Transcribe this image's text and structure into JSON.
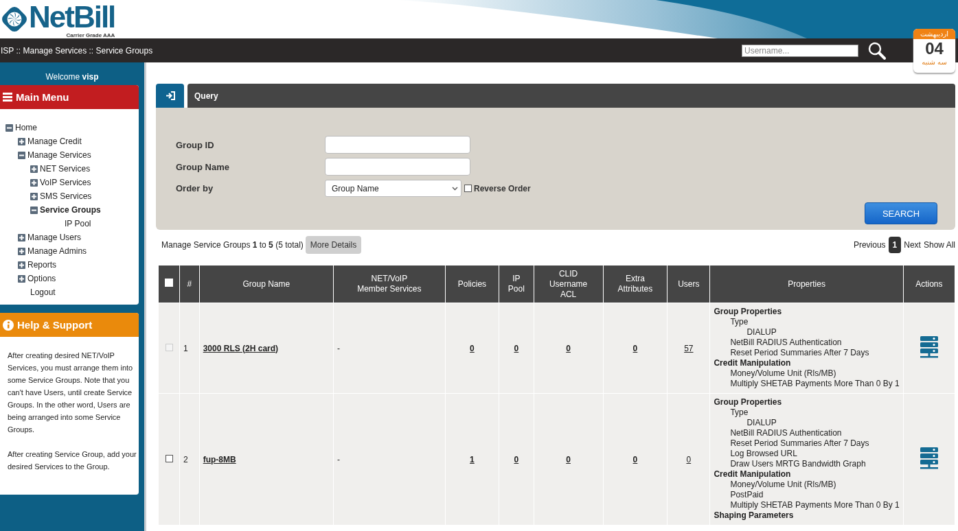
{
  "logo": {
    "name": "NetBill",
    "tagline": "Carrier Grade AAA"
  },
  "breadcrumb": "ISP :: Manage Services :: Service Groups",
  "search": {
    "placeholder": "Username..."
  },
  "calendar": {
    "month": "اردیبهشت",
    "day": "04",
    "weekday": "سه شنبه"
  },
  "sidebar": {
    "welcome": "Welcome **visp**",
    "menu_title": "Main Menu",
    "tree": [
      {
        "label": "Home",
        "kind": "expanded",
        "selected": false,
        "children": [
          {
            "label": "Manage Credit",
            "kind": "collapsed",
            "selected": false
          },
          {
            "label": "Manage Services",
            "kind": "expanded",
            "selected": false,
            "children": [
              {
                "label": "NET Services",
                "kind": "collapsed",
                "selected": false
              },
              {
                "label": "VoIP Services",
                "kind": "collapsed",
                "selected": false
              },
              {
                "label": "SMS Services",
                "kind": "collapsed",
                "selected": false
              },
              {
                "label": "Service Groups",
                "kind": "expanded",
                "selected": true,
                "children": [
                  {
                    "label": "IP Pool",
                    "kind": "leaf",
                    "selected": false
                  }
                ]
              }
            ]
          },
          {
            "label": "Manage Users",
            "kind": "collapsed",
            "selected": false
          },
          {
            "label": "Manage Admins",
            "kind": "collapsed",
            "selected": false
          },
          {
            "label": "Reports",
            "kind": "collapsed",
            "selected": false
          },
          {
            "label": "Options",
            "kind": "collapsed",
            "selected": false
          },
          {
            "label": "Logout",
            "kind": "leaf",
            "selected": false
          }
        ]
      }
    ],
    "help_title": "Help & Support",
    "help_paragraphs": [
      "After creating desired NET/VoIP Services, you must arrange them into some Service Groups. Note that you can't have Users, until create Service Groups. In the other word, Users are being arranged into some Service Groups.",
      "After creating Service Group, add your desired Services to the Group."
    ]
  },
  "query": {
    "title": "Query",
    "fields": [
      {
        "label": "Group ID",
        "kind": "text"
      },
      {
        "label": "Group Name",
        "kind": "text"
      },
      {
        "label": "Order by",
        "kind": "select",
        "value": "Group Name",
        "option_label": "Reverse Order",
        "checked": false
      }
    ],
    "button": "SEARCH"
  },
  "summary": "Manage Service Groups **1** to **5** (5 total)",
  "more_details": "More Details",
  "pagination": {
    "previous": "Previous",
    "pages": [
      {
        "label": "1",
        "selected": true
      }
    ],
    "next": "Next",
    "show_all": "Show All"
  },
  "table": {
    "select_all_checked": false,
    "columns": [
      "#",
      "Group Name",
      "NET/VoIP\nMember Services",
      "Policies",
      "IP\nPool",
      "CLID\nUsername\nACL",
      "Extra\nAttributes",
      "Users",
      "Properties",
      "Actions"
    ],
    "rows": [
      {
        "checked": false,
        "disabled": true,
        "number": "1",
        "name": "3000 RLS (2H card)",
        "members": "-",
        "policies": "0",
        "ip_pool": "0",
        "clid": "0",
        "extra": "0",
        "users": "57",
        "properties": [
          {
            "text": "Group Properties",
            "children": [
              {
                "text": "Type",
                "children": [
                  {
                    "text": "DIALUP"
                  }
                ]
              },
              {
                "text": "NetBill RADIUS Authentication"
              },
              {
                "text": "Reset Period Summaries After 7 Days"
              }
            ]
          },
          {
            "text": "Credit Manipulation",
            "children": [
              {
                "text": "Money/Volume Unit (Rls/MB)"
              },
              {
                "text": "Multiply SHETAB Payments More Than 0 By 1"
              }
            ]
          }
        ]
      },
      {
        "checked": false,
        "disabled": false,
        "number": "2",
        "name": "fup-8MB",
        "members": "-",
        "policies": "1",
        "ip_pool": "0",
        "clid": "0",
        "extra": "0",
        "users": "0",
        "properties": [
          {
            "text": "Group Properties",
            "children": [
              {
                "text": "Type",
                "children": [
                  {
                    "text": "DIALUP"
                  }
                ]
              },
              {
                "text": "NetBill RADIUS Authentication"
              },
              {
                "text": "Reset Period Summaries After 7 Days"
              },
              {
                "text": "Log Browsed URL"
              },
              {
                "text": "Draw Users MRTG Bandwidth Graph"
              }
            ]
          },
          {
            "text": "Credit Manipulation",
            "children": [
              {
                "text": "Money/Volume Unit (Rls/MB)"
              },
              {
                "text": "PostPaid"
              },
              {
                "text": "Multiply SHETAB Payments More Than 0 By 1"
              }
            ]
          },
          {
            "text": "Shaping Parameters"
          }
        ]
      }
    ]
  }
}
